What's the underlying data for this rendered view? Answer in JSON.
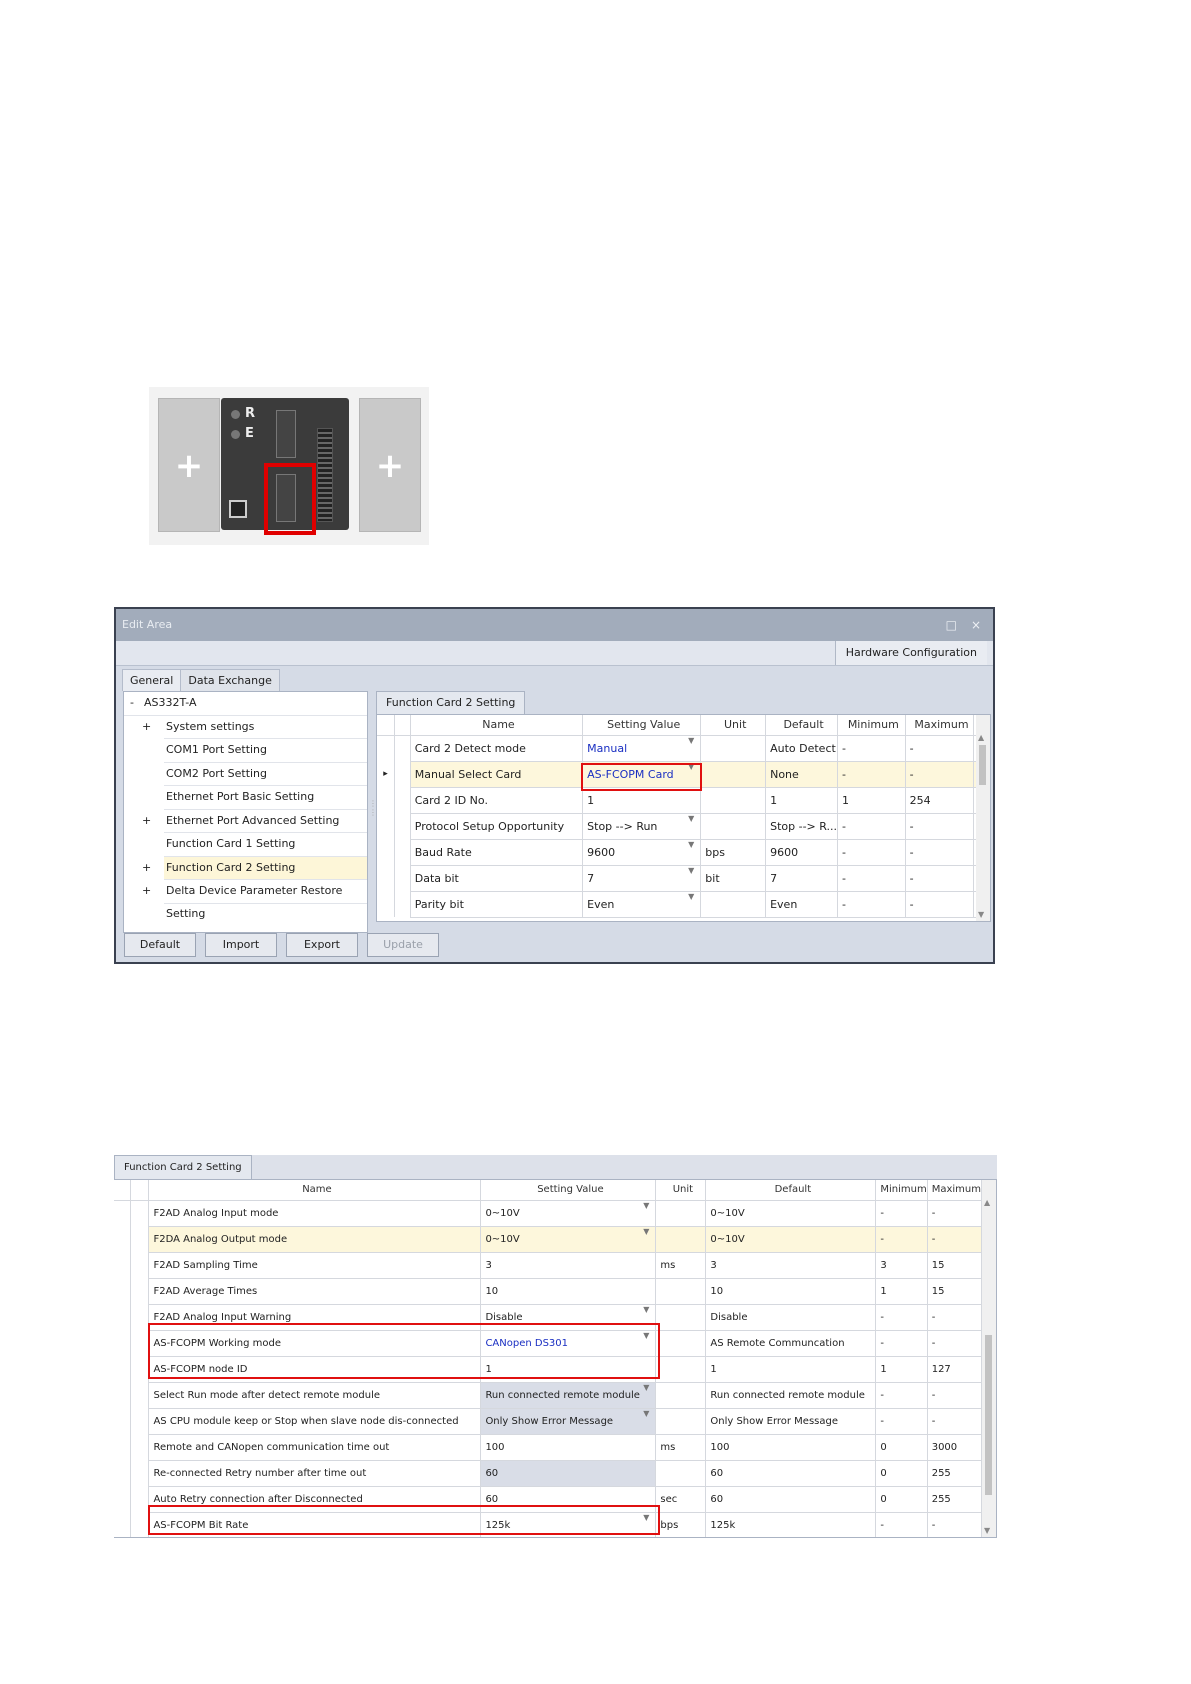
{
  "hardware_image": {
    "led_labels": [
      "R",
      "E"
    ],
    "add_icon": "plus-icon",
    "highlight_color": "#e00000"
  },
  "edit_area": {
    "title": "Edit Area",
    "window_controls": [
      "maximize-icon",
      "close-icon"
    ],
    "hardware_tab": "Hardware Configuration",
    "tabs": [
      "General",
      "Data Exchange"
    ],
    "tree": [
      {
        "label": "AS332T-A",
        "expander": "-",
        "level": 0
      },
      {
        "label": "System settings",
        "expander": "+",
        "level": 1
      },
      {
        "label": "COM1 Port Setting",
        "expander": "",
        "level": 1
      },
      {
        "label": "COM2 Port Setting",
        "expander": "",
        "level": 1
      },
      {
        "label": "Ethernet Port Basic Setting",
        "expander": "",
        "level": 1
      },
      {
        "label": "Ethernet Port Advanced Setting",
        "expander": "+",
        "level": 1
      },
      {
        "label": "Function Card 1 Setting",
        "expander": "",
        "level": 1
      },
      {
        "label": "Function Card 2 Setting",
        "expander": "+",
        "level": 1,
        "selected": true
      },
      {
        "label": "Delta Device Parameter Restore Setting",
        "expander": "+",
        "level": 1
      }
    ],
    "panel_tab": "Function Card 2 Setting",
    "columns": [
      "Name",
      "Setting Value",
      "Unit",
      "Default",
      "Minimum",
      "Maximum"
    ],
    "rows": [
      {
        "name": "Card 2 Detect mode",
        "value": "Manual",
        "dropdown": true,
        "blue": true,
        "unit": "",
        "default": "Auto Detect",
        "min": "-",
        "max": "-"
      },
      {
        "name": "Manual Select Card",
        "value": "AS-FCOPM Card",
        "dropdown": true,
        "blue": true,
        "unit": "",
        "default": "None",
        "min": "-",
        "max": "-",
        "current": true,
        "highlight": true
      },
      {
        "name": "Card 2 ID No.",
        "value": "1",
        "unit": "",
        "default": "1",
        "min": "1",
        "max": "254"
      },
      {
        "name": "Protocol Setup Opportunity",
        "value": "Stop --> Run",
        "dropdown": true,
        "unit": "",
        "default": "Stop --> R...",
        "min": "-",
        "max": "-"
      },
      {
        "name": "Baud Rate",
        "value": "9600",
        "dropdown": true,
        "unit": "bps",
        "default": "9600",
        "min": "-",
        "max": "-"
      },
      {
        "name": "Data bit",
        "value": "7",
        "dropdown": true,
        "unit": "bit",
        "default": "7",
        "min": "-",
        "max": "-"
      },
      {
        "name": "Parity bit",
        "value": "Even",
        "dropdown": true,
        "unit": "",
        "default": "Even",
        "min": "-",
        "max": "-"
      }
    ],
    "buttons": [
      {
        "label": "Default"
      },
      {
        "label": "Import"
      },
      {
        "label": "Export"
      },
      {
        "label": "Update",
        "disabled": true
      }
    ]
  },
  "card_table": {
    "panel_tab": "Function Card 2 Setting",
    "columns": [
      "Name",
      "Setting Value",
      "Unit",
      "Default",
      "Minimum",
      "Maximum"
    ],
    "rows": [
      {
        "name": "F2AD Analog Input mode",
        "value": "0~10V",
        "dropdown": true,
        "unit": "",
        "default": "0~10V",
        "min": "-",
        "max": "-"
      },
      {
        "name": "F2DA Analog Output mode",
        "value": "0~10V",
        "dropdown": true,
        "unit": "",
        "default": "0~10V",
        "min": "-",
        "max": "-",
        "highlight": true
      },
      {
        "name": "F2AD Sampling Time",
        "value": "3",
        "unit": "ms",
        "default": "3",
        "min": "3",
        "max": "15"
      },
      {
        "name": "F2AD Average Times",
        "value": "10",
        "unit": "",
        "default": "10",
        "min": "1",
        "max": "15"
      },
      {
        "name": "F2AD Analog Input Warning",
        "value": "Disable",
        "dropdown": true,
        "unit": "",
        "default": "Disable",
        "min": "-",
        "max": "-"
      },
      {
        "name": "AS-FCOPM Working mode",
        "value": "CANopen DS301",
        "dropdown": true,
        "blue": true,
        "unit": "",
        "default": "AS Remote Communcation",
        "min": "-",
        "max": "-"
      },
      {
        "name": "AS-FCOPM node ID",
        "value": "1",
        "unit": "",
        "default": "1",
        "min": "1",
        "max": "127"
      },
      {
        "name": "Select Run mode after detect remote module",
        "value": "Run connected remote module",
        "dropdown": true,
        "disabled": true,
        "unit": "",
        "default": "Run connected remote module",
        "min": "-",
        "max": "-"
      },
      {
        "name": "AS CPU module keep or Stop when slave node dis-connected",
        "value": "Only Show Error Message",
        "dropdown": true,
        "disabled": true,
        "unit": "",
        "default": "Only Show Error Message",
        "min": "-",
        "max": "-"
      },
      {
        "name": "Remote and CANopen communication time out",
        "value": "100",
        "unit": "ms",
        "default": "100",
        "min": "0",
        "max": "3000"
      },
      {
        "name": "Re-connected Retry number after time out",
        "value": "60",
        "disabled": true,
        "unit": "",
        "default": "60",
        "min": "0",
        "max": "255"
      },
      {
        "name": "Auto Retry connection after Disconnected",
        "value": "60",
        "unit": "sec",
        "default": "60",
        "min": "0",
        "max": "255"
      },
      {
        "name": "AS-FCOPM Bit Rate",
        "value": "125k",
        "dropdown": true,
        "unit": "bps",
        "default": "125k",
        "min": "-",
        "max": "-"
      }
    ]
  }
}
